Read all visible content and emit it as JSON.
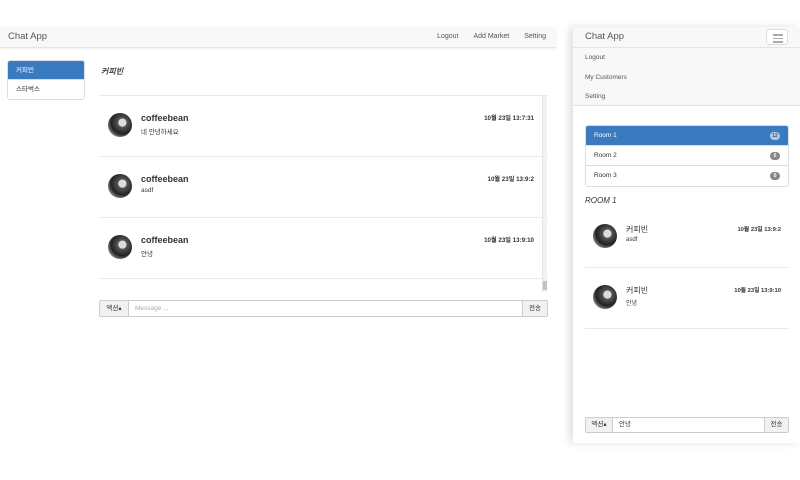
{
  "desktop": {
    "brand": "Chat App",
    "nav": [
      "Logout",
      "Add Market",
      "Setting"
    ],
    "sidebar": [
      {
        "label": "커피빈",
        "active": true
      },
      {
        "label": "스타벅스",
        "active": false
      }
    ],
    "room_title": "커피빈",
    "messages": [
      {
        "name": "coffeebean",
        "text": "네 안녕하세요",
        "time": "10월 23일 13:7:31"
      },
      {
        "name": "coffeebean",
        "text": "asdf",
        "time": "10월 23일 13:9:2"
      },
      {
        "name": "coffeebean",
        "text": "안녕",
        "time": "10월 23일 13:9:10"
      }
    ],
    "input": {
      "action_label": "액션▴",
      "placeholder": "Message ...",
      "send_label": "전송"
    }
  },
  "mobile": {
    "brand": "Chat App",
    "menu": [
      "Logout",
      "My Customers",
      "Setting"
    ],
    "rooms": [
      {
        "label": "Room 1",
        "badge": "12",
        "active": true
      },
      {
        "label": "Room 2",
        "badge": "0",
        "active": false
      },
      {
        "label": "Room 3",
        "badge": "0",
        "active": false
      }
    ],
    "room_title": "ROOM 1",
    "messages": [
      {
        "name": "커피빈",
        "text": "asdf",
        "time": "10월 23일 13:9:2"
      },
      {
        "name": "커피빈",
        "text": "안녕",
        "time": "10월 23일 13:9:10"
      }
    ],
    "input": {
      "action_label": "액션▴",
      "value": "안녕",
      "send_label": "전송"
    }
  },
  "icons": {
    "menu": "hamburger-icon",
    "avatar": "avatar-image"
  },
  "colors": {
    "accent": "#3a7bc0",
    "badge": "#888888"
  }
}
